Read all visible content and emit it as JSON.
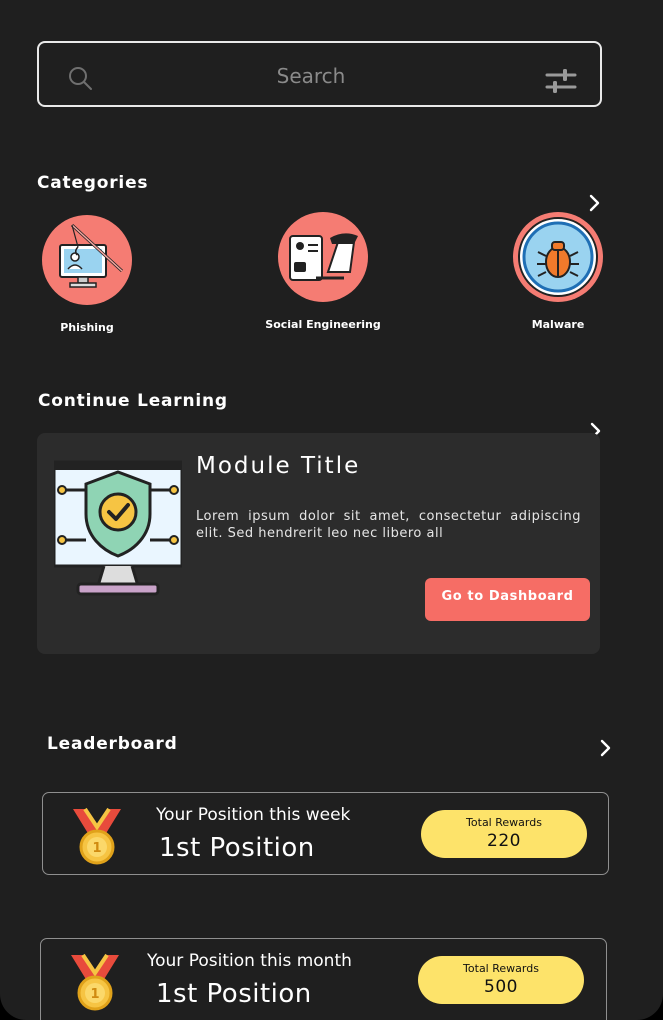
{
  "search": {
    "placeholder": "Search"
  },
  "categories": {
    "title": "Categories",
    "items": [
      {
        "label": "Phishing",
        "icon": "phishing-icon"
      },
      {
        "label": "Social Engineering",
        "icon": "social-engineering-icon"
      },
      {
        "label": "Malware",
        "icon": "malware-bug-icon"
      }
    ]
  },
  "continue_learning": {
    "title": "Continue Learning",
    "module": {
      "title": "Module Title",
      "description": "Lorem ipsum dolor sit amet, consectetur adipiscing elit. Sed hendrerit leo nec libero all",
      "button_label": "Go to Dashboard",
      "image": "security-shield-monitor-icon"
    }
  },
  "leaderboard": {
    "title": "Leaderboard",
    "entries": [
      {
        "period": "Your Position this week",
        "position": "1st Position",
        "rewards_label": "Total Rewards",
        "rewards_value": "220"
      },
      {
        "period": "Your Position this month",
        "position": "1st Position",
        "rewards_label": "Total Rewards",
        "rewards_value": "500"
      }
    ]
  },
  "colors": {
    "background": "#1f1f1f",
    "accent": "#f66d65",
    "category_circle": "#f57c73",
    "rewards_pill": "#fde36a",
    "card": "#2c2c2c"
  }
}
